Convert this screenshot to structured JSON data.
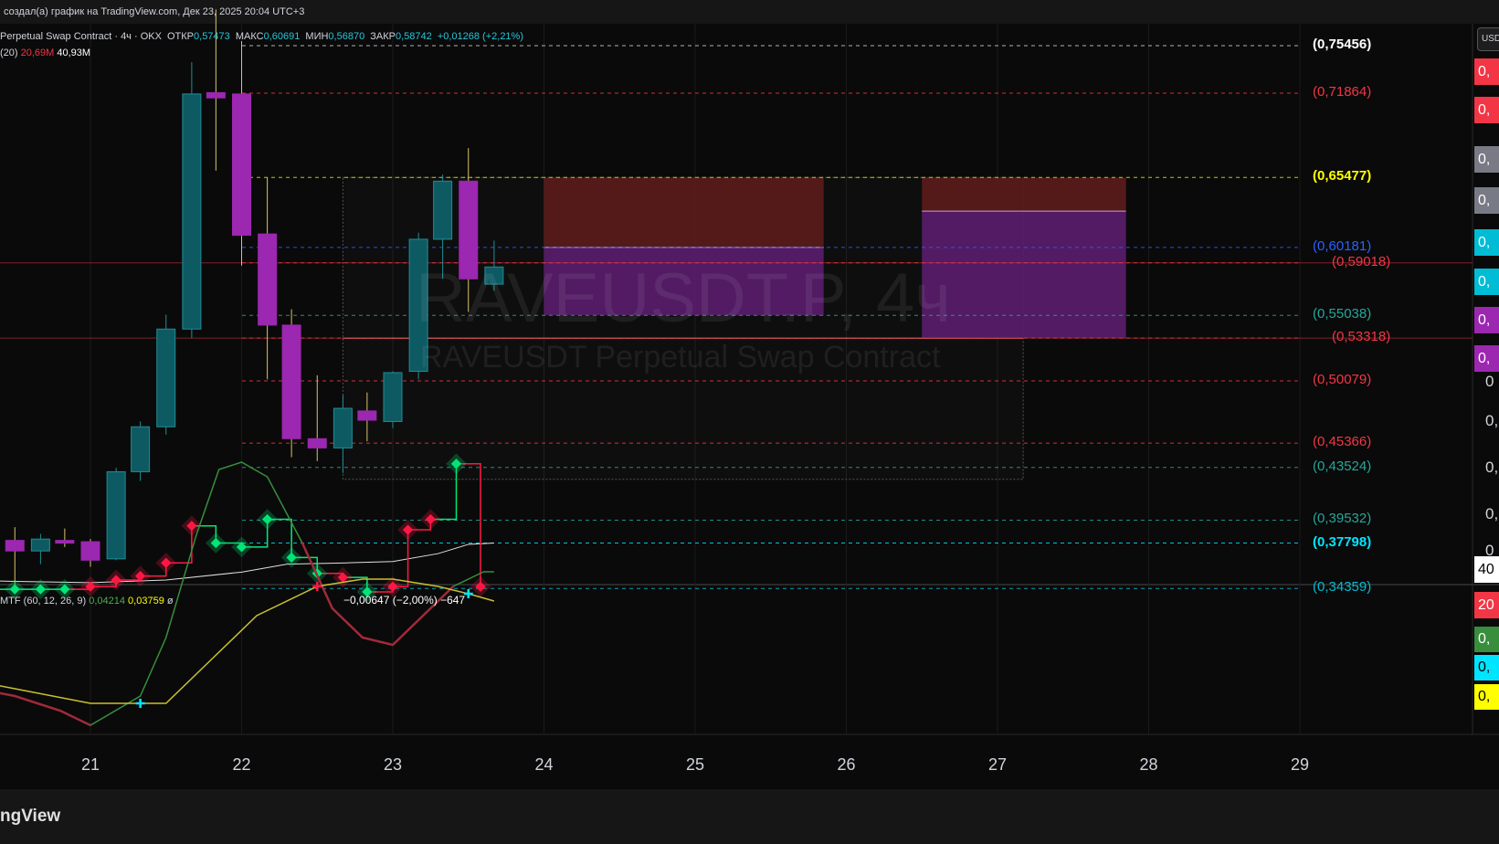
{
  "header": {
    "title": "создал(а) график на TradingView.com, Дек 23, 2025 20:04 UTC+3"
  },
  "legend": {
    "symbol": "Perpetual Swap Contract · 4ч · OKX",
    "open_label": "ОТКР",
    "open": "0,57473",
    "high_label": "МАКС",
    "high": "0,60691",
    "low_label": "МИН",
    "low": "0,56870",
    "close_label": "ЗАКР",
    "close": "0,58742",
    "change": "+0,01268 (+2,21%)",
    "vol_prefix": "(20)",
    "vol1": "20,69M",
    "vol2": "40,93M"
  },
  "watermark": {
    "ticker": "RAVEUSDT.P, 4ч",
    "name": "RAVEUSDT Perpetual Swap Contract"
  },
  "currency_button": "USD",
  "price_levels": [
    {
      "label": "(0,75456)",
      "price": 0.75456,
      "color": "#ffffff",
      "line": "#cfcfcf",
      "bold": true
    },
    {
      "label": "(0,71864)",
      "price": 0.71864,
      "color": "#f23645",
      "line": "#f23645",
      "bold": false
    },
    {
      "label": "(0,65477)",
      "price": 0.65477,
      "color": "#ffff00",
      "line": "#e6e600",
      "bold": true
    },
    {
      "label": "(0,60181)",
      "price": 0.60181,
      "color": "#2962ff",
      "line": "#2962ff",
      "bold": false
    },
    {
      "label": "(0,59018)",
      "price": 0.59018,
      "color": "#f23645",
      "line": "#f23645",
      "bold": false
    },
    {
      "label": "(0,55038)",
      "price": 0.55038,
      "color": "#26a69a",
      "line": "#26a69a",
      "bold": false
    },
    {
      "label": "(0,53318)",
      "price": 0.53318,
      "color": "#f23645",
      "line": "#f23645",
      "bold": false
    },
    {
      "label": "(0,50079)",
      "price": 0.50079,
      "color": "#f23645",
      "line": "#f23645",
      "bold": false
    },
    {
      "label": "(0,45366)",
      "price": 0.45366,
      "color": "#f23645",
      "line": "#f23645",
      "bold": false
    },
    {
      "label": "(0,43524)",
      "price": 0.43524,
      "color": "#26a69a",
      "line": "#26a69a",
      "bold": false
    },
    {
      "label": "(0,39532)",
      "price": 0.39532,
      "color": "#26a69a",
      "line": "#26a69a",
      "bold": false
    },
    {
      "label": "(0,37798)",
      "price": 0.37798,
      "color": "#00e5ff",
      "line": "#00e5ff",
      "bold": true
    },
    {
      "label": "(0,34359)",
      "price": 0.34359,
      "color": "#00bcd4",
      "line": "#00bcd4",
      "bold": false
    }
  ],
  "right_tags": [
    {
      "text": "0,",
      "bg": "#f23645",
      "color": "#ffffff",
      "price": 0.735
    },
    {
      "text": "0,",
      "bg": "#f23645",
      "color": "#ffffff",
      "price": 0.706
    },
    {
      "text": "0,",
      "bg": "#787b86",
      "color": "#ffffff",
      "price": 0.669
    },
    {
      "text": "0,",
      "bg": "#787b86",
      "color": "#ffffff",
      "price": 0.638
    },
    {
      "text": "0,",
      "bg": "#00bcd4",
      "color": "#ffffff",
      "price": 0.606
    },
    {
      "text": "0,",
      "bg": "#00bcd4",
      "color": "#ffffff",
      "price": 0.576
    },
    {
      "text": "0,",
      "bg": "#9c27b0",
      "color": "#ffffff",
      "price": 0.547
    },
    {
      "text": "0,",
      "bg": "#9c27b0",
      "color": "#ffffff",
      "price": 0.518
    },
    {
      "text": "40",
      "bg": "#ffffff",
      "color": "#000000",
      "price": 0.358
    },
    {
      "text": "20",
      "bg": "#f23645",
      "color": "#ffffff",
      "price": 0.331
    }
  ],
  "right_scale": [
    {
      "text": "0",
      "price": 0.5
    },
    {
      "text": "0,",
      "price": 0.47
    },
    {
      "text": "0,",
      "price": 0.435
    },
    {
      "text": "0,",
      "price": 0.4
    },
    {
      "text": "0",
      "price": 0.372
    }
  ],
  "macd": {
    "legend_name": "MTF (60, 12, 26, 9)",
    "val1": "0,04214",
    "val2": "0,03759",
    "val3": "ø",
    "tags": [
      {
        "text": "0,",
        "bg": "#388e3c",
        "color": "#ffffff"
      },
      {
        "text": "0,",
        "bg": "#00e5ff",
        "color": "#000000"
      },
      {
        "text": "0,",
        "bg": "#ffff00",
        "color": "#000000"
      }
    ]
  },
  "x_axis": {
    "labels": [
      "21",
      "22",
      "23",
      "24",
      "25",
      "26",
      "27",
      "28",
      "29"
    ],
    "days": [
      21,
      22,
      23,
      24,
      25,
      26,
      27,
      28,
      29
    ]
  },
  "pnl_label": "−0,00647 (−2,00%) −647",
  "footer": {
    "logo": "ngView"
  },
  "colors": {
    "up": "#0e5a63",
    "up_border": "#1f8c96",
    "down": "#9c27b0",
    "wick": "#d7c56a"
  },
  "candles": [
    {
      "t": 20.5,
      "o": 0.38,
      "h": 0.39,
      "l": 0.345,
      "c": 0.372
    },
    {
      "t": 20.67,
      "o": 0.372,
      "h": 0.385,
      "l": 0.362,
      "c": 0.381
    },
    {
      "t": 20.83,
      "o": 0.38,
      "h": 0.389,
      "l": 0.375,
      "c": 0.379
    },
    {
      "t": 21.0,
      "o": 0.379,
      "h": 0.381,
      "l": 0.36,
      "c": 0.365
    },
    {
      "t": 21.17,
      "o": 0.366,
      "h": 0.435,
      "l": 0.365,
      "c": 0.432
    },
    {
      "t": 21.33,
      "o": 0.432,
      "h": 0.47,
      "l": 0.425,
      "c": 0.466
    },
    {
      "t": 21.5,
      "o": 0.466,
      "h": 0.551,
      "l": 0.46,
      "c": 0.54
    },
    {
      "t": 21.67,
      "o": 0.54,
      "h": 0.742,
      "l": 0.533,
      "c": 0.718
    },
    {
      "t": 21.83,
      "o": 0.719,
      "h": 0.782,
      "l": 0.66,
      "c": 0.715
    },
    {
      "t": 22.0,
      "o": 0.718,
      "h": 0.758,
      "l": 0.588,
      "c": 0.611
    },
    {
      "t": 22.17,
      "o": 0.612,
      "h": 0.655,
      "l": 0.502,
      "c": 0.543
    },
    {
      "t": 22.33,
      "o": 0.543,
      "h": 0.555,
      "l": 0.443,
      "c": 0.457
    },
    {
      "t": 22.5,
      "o": 0.457,
      "h": 0.505,
      "l": 0.44,
      "c": 0.45
    },
    {
      "t": 22.67,
      "o": 0.45,
      "h": 0.49,
      "l": 0.431,
      "c": 0.48
    },
    {
      "t": 22.83,
      "o": 0.478,
      "h": 0.492,
      "l": 0.455,
      "c": 0.471
    },
    {
      "t": 23.0,
      "o": 0.47,
      "h": 0.508,
      "l": 0.465,
      "c": 0.507
    },
    {
      "t": 23.17,
      "o": 0.508,
      "h": 0.613,
      "l": 0.502,
      "c": 0.608
    },
    {
      "t": 23.33,
      "o": 0.608,
      "h": 0.657,
      "l": 0.578,
      "c": 0.652
    },
    {
      "t": 23.5,
      "o": 0.652,
      "h": 0.677,
      "l": 0.553,
      "c": 0.578
    },
    {
      "t": 23.67,
      "o": 0.574,
      "h": 0.607,
      "l": 0.569,
      "c": 0.587
    }
  ],
  "positions": [
    {
      "t0": 24.0,
      "t1": 25.85,
      "entry": 0.60181,
      "tp": 0.65477,
      "sl": 0.55038
    },
    {
      "t0": 26.5,
      "t1": 27.85,
      "entry": 0.6293,
      "tp": 0.65477,
      "sl": 0.53318
    }
  ]
}
